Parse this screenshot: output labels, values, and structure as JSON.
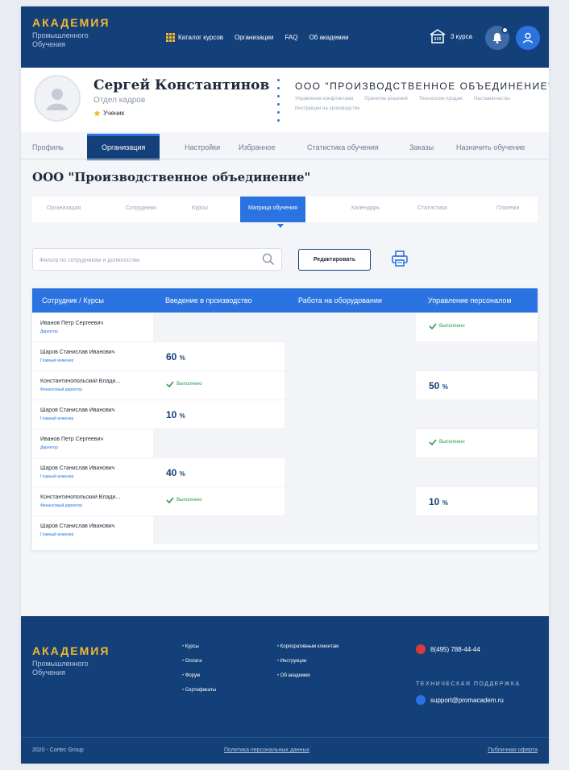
{
  "header": {
    "logo_title": "АКАДЕМИЯ",
    "logo_subtitle": "Промышленного Обучения",
    "nav": [
      "Каталог курсов",
      "Организации",
      "FAQ",
      "Об академии"
    ],
    "cart_label": "3 курса"
  },
  "profile": {
    "name": "Сергей Константинов",
    "department": "Отдел кадров",
    "role": "Ученик",
    "org_name": "ООО \"ПРОИЗВОДСТВЕННОЕ ОБЪЕДИНЕНИЕ\"",
    "org_tags": [
      "Управление конфликтами",
      "Принятие решений",
      "Технологии продаж",
      "Наставничество",
      "Инструкции на производстве"
    ]
  },
  "main_tabs": [
    "Профиль",
    "Организация",
    "Настройки",
    "Избранное",
    "Статистика обучения",
    "Заказы",
    "Назначить обучение"
  ],
  "page_title": "ООО \"Производственное объединение\"",
  "sub_tabs": [
    "Организация",
    "Сотрудники",
    "Курсы",
    "Матрица обучения",
    "Календарь",
    "Статистика",
    "Платежи"
  ],
  "filter": {
    "placeholder": "Фильтр по сотрудникам и должностям",
    "value": ""
  },
  "edit_label": "Редактировать",
  "table": {
    "headers": [
      "Сотрудник / Курсы",
      "Введение в производство",
      "Работа на оборудовании",
      "Управление персоналом"
    ],
    "done_label": "Выполнено",
    "rows": [
      {
        "name": "Иванов Петр Сергеевич",
        "position": "Директор",
        "c1": "",
        "c2": "",
        "c3": "Выполнено"
      },
      {
        "name": "Шаров Станислав Иванович",
        "position": "Главный инженер",
        "c1": "60",
        "c2": "",
        "c3": ""
      },
      {
        "name": "Константинопольский Влади...",
        "position": "Финансовый директор",
        "c1": "Выполнено",
        "c2": "",
        "c3": "50"
      },
      {
        "name": "Шаров Станислав Иванович",
        "position": "Главный инженер",
        "c1": "10",
        "c2": "",
        "c3": ""
      },
      {
        "name": "Иванов Петр Сергеевич",
        "position": "Директор",
        "c1": "",
        "c2": "",
        "c3": "Выполнено"
      },
      {
        "name": "Шаров Станислав Иванович",
        "position": "Главный инженер",
        "c1": "40",
        "c2": "",
        "c3": ""
      },
      {
        "name": "Константинопольский Влади...",
        "position": "Финансовый директор",
        "c1": "Выполнено",
        "c2": "",
        "c3": "10"
      },
      {
        "name": "Шаров Станислав Иванович",
        "position": "Главный инженер",
        "c1": "",
        "c2": "",
        "c3": ""
      }
    ]
  },
  "footer": {
    "logo_title": "АКАДЕМИЯ",
    "logo_subtitle": "Промышленного Обучения",
    "col1": [
      "Курсы",
      "Оплата",
      "Форум",
      "Сертификаты"
    ],
    "col2": [
      "Корпоративным клиентам",
      "Инструкции",
      "Об академии"
    ],
    "phone": "8(495) 788-44-44",
    "support_label": "ТЕХНИЧЕСКАЯ ПОДДЕРЖКА",
    "email": "support@promacadem.ru",
    "copyright": "2020 - Cortec Group",
    "policy": "Политика персональных данных",
    "offer": "Публичная оферта"
  },
  "colors": {
    "primary": "#14407a",
    "accent": "#2a73e0",
    "logo": "#f5b82e",
    "success": "#2a9d4a"
  }
}
